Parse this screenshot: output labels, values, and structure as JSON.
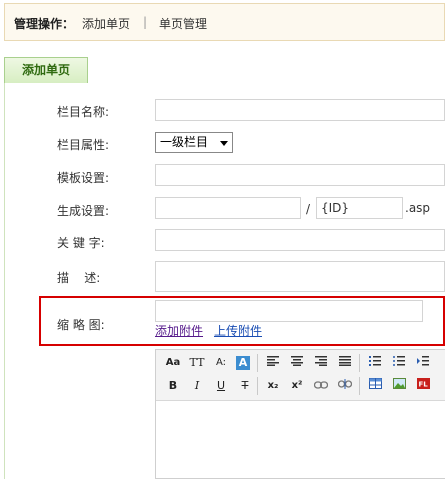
{
  "topbar": {
    "title": "管理操作：",
    "link_add": "添加单页",
    "divider": "|",
    "link_manage": "单页管理"
  },
  "tab": {
    "label": "添加单页"
  },
  "form": {
    "column_name_label": "栏目名称:",
    "column_attr_label": "栏目属性:",
    "column_attr_value": "一级栏目",
    "template_label": "模板设置:",
    "generate_label": "生成设置:",
    "generate_slash": "/",
    "generate_id_value": "{ID}",
    "generate_ext": ".asp",
    "keywords_label": "关 键 字:",
    "description_label": "描    述:",
    "thumbnail_label": "缩 略 图:",
    "add_attachment_link": "添加附件",
    "upload_attachment_link": "上传附件"
  },
  "editor_toolbar": {
    "row1": [
      "font-name-icon",
      "font-size-icon",
      "font-style-icon",
      "text-color-icon",
      "align-left-icon",
      "align-center-icon",
      "align-right-icon",
      "align-justify-icon",
      "ordered-list-icon",
      "unordered-list-icon",
      "indent-icon"
    ],
    "row2": [
      "bold-icon",
      "italic-icon",
      "underline-icon",
      "strikethrough-icon",
      "subscript-icon",
      "superscript-icon",
      "link-icon",
      "unlink-icon",
      "table-icon",
      "image-icon",
      "flash-icon"
    ],
    "glyphs": {
      "font_name": "Aa",
      "font_size": "TT",
      "font_style": "A:",
      "text_color": "A",
      "bold": "B",
      "italic": "I",
      "underline": "U",
      "strike": "T",
      "sub": "x₂",
      "sup": "x²"
    }
  },
  "colors": {
    "highlight_border": "#d60000",
    "tab_text": "#2f6a10",
    "link": "#1a4db3"
  }
}
